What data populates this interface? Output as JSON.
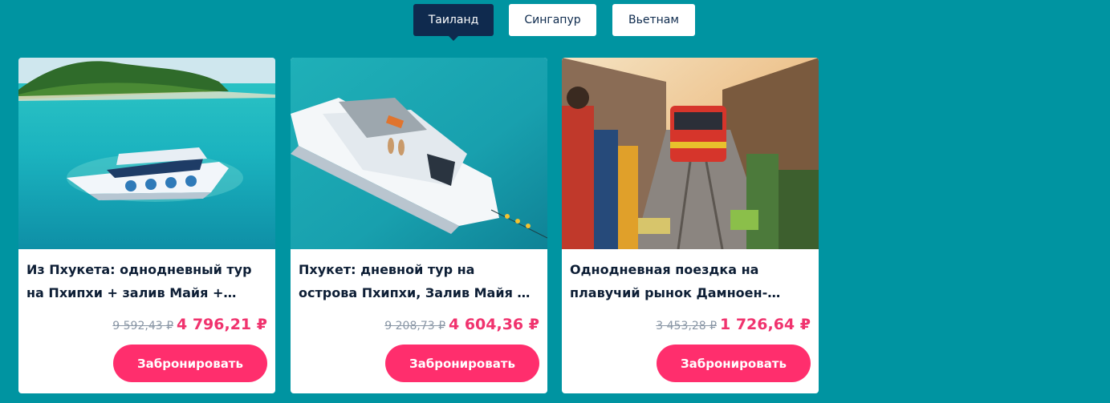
{
  "tabs": [
    {
      "label": "Таиланд",
      "active": true
    },
    {
      "label": "Сингапур",
      "active": false
    },
    {
      "label": "Вьетнам",
      "active": false
    }
  ],
  "cards": [
    {
      "title": "Из Пхукета: однодневный тур на Пхипхи + залив Майя + остров Хай с обедом",
      "old_price": "9 592,43 ₽",
      "new_price": "4 796,21 ₽",
      "button_label": "Забронировать",
      "image": "speedboat-on-turquoise-sea"
    },
    {
      "title": "Пхукет: дневной тур на острова Пхипхи, Залив Майя и острова Бамбук",
      "old_price": "9 208,73 ₽",
      "new_price": "4 604,36 ₽",
      "button_label": "Забронировать",
      "image": "yacht-aerial-view"
    },
    {
      "title": "Однодневная поездка на плавучий рынок Дамноен-Садуак и рынок на железной дороге",
      "old_price": "3 453,28 ₽",
      "new_price": "1 726,64 ₽",
      "button_label": "Забронировать",
      "image": "railway-market-train"
    }
  ],
  "colors": {
    "background": "#0094a1",
    "tab_active": "#0f2a4e",
    "price_accent": "#f0336e",
    "button": "#ff2e6d"
  }
}
